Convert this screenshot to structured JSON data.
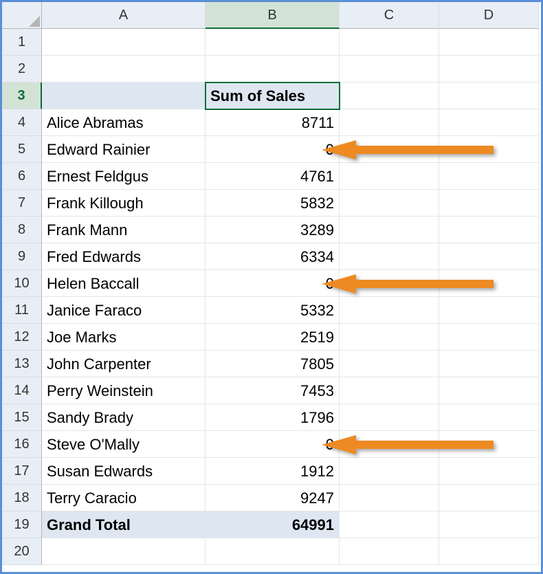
{
  "columns": [
    "A",
    "B",
    "C",
    "D"
  ],
  "selectedColumn": "B",
  "selectedRow": 3,
  "activeCell": {
    "col": "B",
    "row": 3
  },
  "headerRow": 3,
  "totalRow": 19,
  "headerLabel": "Sum of Sales",
  "total": {
    "label": "Grand Total",
    "value": 64991
  },
  "rows": [
    {
      "n": 1
    },
    {
      "n": 2
    },
    {
      "n": 3,
      "a": "",
      "b_header": true
    },
    {
      "n": 4,
      "a": "Alice Abramas",
      "b": 8711
    },
    {
      "n": 5,
      "a": "Edward Rainier",
      "b": 0,
      "arrow": true
    },
    {
      "n": 6,
      "a": "Ernest Feldgus",
      "b": 4761
    },
    {
      "n": 7,
      "a": "Frank Killough",
      "b": 5832
    },
    {
      "n": 8,
      "a": "Frank Mann",
      "b": 3289
    },
    {
      "n": 9,
      "a": "Fred Edwards",
      "b": 6334
    },
    {
      "n": 10,
      "a": "Helen Baccall",
      "b": 0,
      "arrow": true
    },
    {
      "n": 11,
      "a": "Janice Faraco",
      "b": 5332
    },
    {
      "n": 12,
      "a": "Joe Marks",
      "b": 2519
    },
    {
      "n": 13,
      "a": "John Carpenter",
      "b": 7805
    },
    {
      "n": 14,
      "a": "Perry Weinstein",
      "b": 7453
    },
    {
      "n": 15,
      "a": "Sandy Brady",
      "b": 1796
    },
    {
      "n": 16,
      "a": "Steve O'Mally",
      "b": 0,
      "arrow": true
    },
    {
      "n": 17,
      "a": "Susan Edwards",
      "b": 1912
    },
    {
      "n": 18,
      "a": "Terry Caracio",
      "b": 9247
    },
    {
      "n": 19,
      "total": true
    },
    {
      "n": 20
    }
  ],
  "arrowColor": "#ed8a22"
}
